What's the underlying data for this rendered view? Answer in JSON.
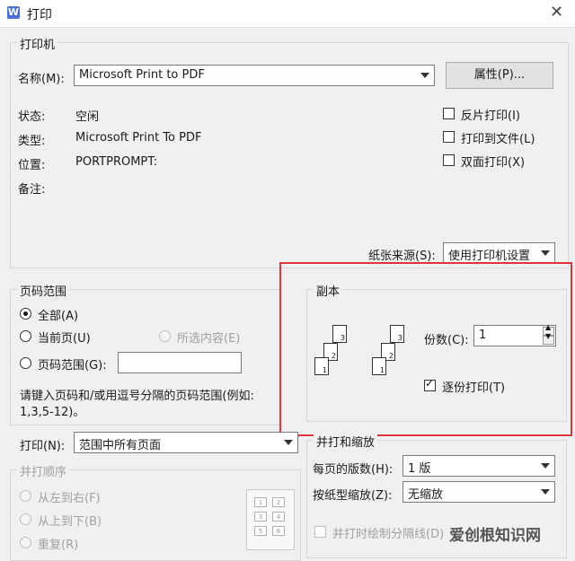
{
  "window": {
    "title": "打印",
    "app_icon": "W"
  },
  "printer": {
    "legend": "打印机",
    "name_label": "名称(M):",
    "name_value": "Microsoft Print to PDF",
    "properties_button": "属性(P)...",
    "status_label": "状态:",
    "status_value": "空闲",
    "type_label": "类型:",
    "type_value": "Microsoft Print To PDF",
    "location_label": "位置:",
    "location_value": "PORTPROMPT:",
    "comment_label": "备注:",
    "options": [
      {
        "label": "反片打印(I)",
        "checked": false
      },
      {
        "label": "打印到文件(L)",
        "checked": false
      },
      {
        "label": "双面打印(X)",
        "checked": false
      }
    ],
    "paper_source_label": "纸张来源(S):",
    "paper_source_value": "使用打印机设置"
  },
  "page_range": {
    "legend": "页码范围",
    "all": "全部(A)",
    "current": "当前页(U)",
    "selection": "所选内容(E)",
    "range": "页码范围(G):",
    "range_value": "",
    "hint_line1": "请键入页码和/或用逗号分隔的页码范围(例如:",
    "hint_line2": "1,3,5-12)。"
  },
  "copies": {
    "legend": "副本",
    "count_label": "份数(C):",
    "count_value": "1",
    "collate_label": "逐份打印(T)",
    "collate_checked": true,
    "pages_set_a": [
      "1",
      "2",
      "3"
    ],
    "pages_set_b": [
      "1",
      "2",
      "3"
    ]
  },
  "print_what": {
    "label": "打印(N):",
    "value": "范围中所有页面"
  },
  "print_order": {
    "legend": "并打顺序",
    "options": [
      "从左到右(F)",
      "从上到下(B)",
      "重复(R)"
    ],
    "mini_pages": [
      "1",
      "2",
      "3",
      "4",
      "5",
      "6"
    ]
  },
  "zoom": {
    "legend": "并打和缩放",
    "per_sheet_label": "每页的版数(H):",
    "per_sheet_value": "1 版",
    "scale_label": "按纸型缩放(Z):",
    "scale_value": "无缩放",
    "draw_lines_label": "并打时绘制分隔线(D)"
  },
  "watermark": "爱创根知识网",
  "colors": {
    "highlight": "#e0343c"
  }
}
